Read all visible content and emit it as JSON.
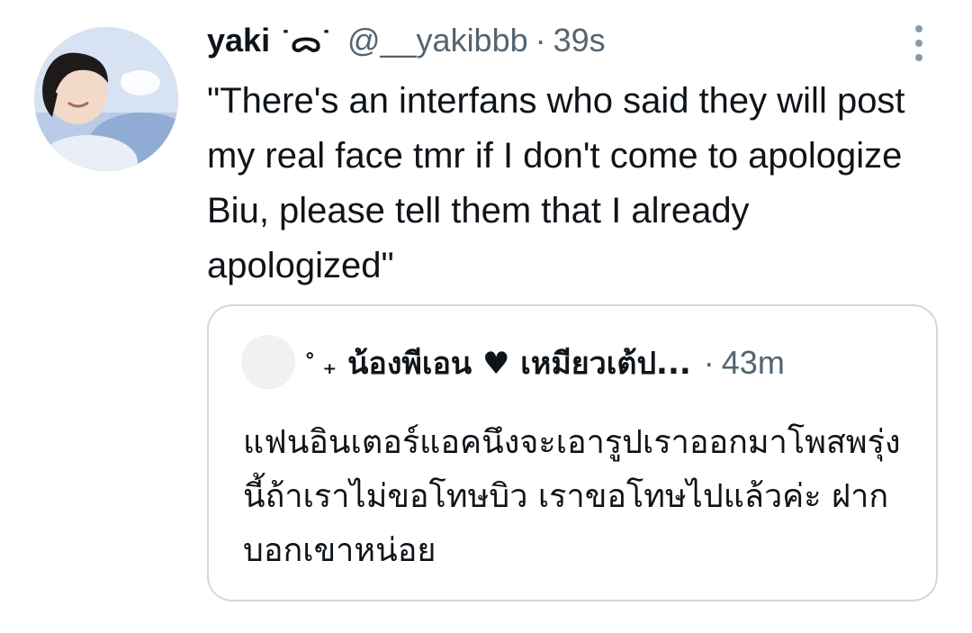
{
  "tweet": {
    "display_name": "yaki",
    "name_decoration": "˙ᯅ˙",
    "handle": "@__yakibbb",
    "separator": "·",
    "time": "39s",
    "text": "\"There's an interfans who said they will post my real face tmr if I don't come to apologize Biu, please tell them that I already apologized\"",
    "avatar_icon": "profile-photo",
    "more_icon": "vertical-ellipsis-icon"
  },
  "quote": {
    "name_decoration": "˚ ₊",
    "display_name": "น้องพีเอน ♥ เหมียวเต้ป...",
    "separator": "·",
    "time": "43m",
    "text": "แฟนอินเตอร์แอคนึงจะเอารูปเราออกมาโพสพรุ่งนี้ถ้าเราไม่ขอโทษบิว เราขอโทษไปแล้วค่ะ ฝากบอกเขาหน่อย"
  },
  "colors": {
    "primary_text": "#0f1419",
    "secondary_text": "#536471",
    "border": "#cfd9de",
    "background": "#ffffff"
  }
}
